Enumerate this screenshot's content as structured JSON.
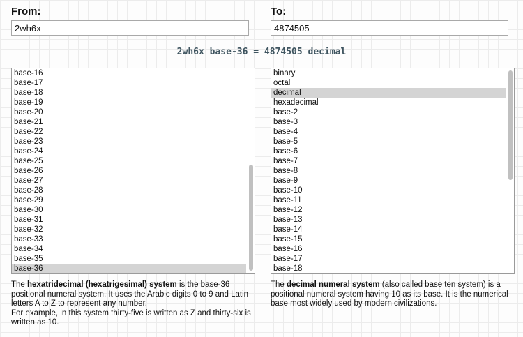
{
  "from": {
    "label": "From:",
    "value": "2wh6x"
  },
  "to": {
    "label": "To:",
    "value": "4874505"
  },
  "result_text": "2wh6x base-36 = 4874505 decimal",
  "from_list": {
    "items": [
      "base-16",
      "base-17",
      "base-18",
      "base-19",
      "base-20",
      "base-21",
      "base-22",
      "base-23",
      "base-24",
      "base-25",
      "base-26",
      "base-27",
      "base-28",
      "base-29",
      "base-30",
      "base-31",
      "base-32",
      "base-33",
      "base-34",
      "base-35",
      "base-36"
    ],
    "selected": "base-36"
  },
  "to_list": {
    "items": [
      "binary",
      "octal",
      "decimal",
      "hexadecimal",
      "base-2",
      "base-3",
      "base-4",
      "base-5",
      "base-6",
      "base-7",
      "base-8",
      "base-9",
      "base-10",
      "base-11",
      "base-12",
      "base-13",
      "base-14",
      "base-15",
      "base-16",
      "base-17",
      "base-18"
    ],
    "selected": "decimal"
  },
  "from_desc": {
    "pre": "The ",
    "bold": "hexatridecimal (hexatrigesimal) system",
    "post": " is the base-36 positional numeral system. It uses the Arabic digits 0 to 9 and Latin letters A to Z to represent any number.",
    "line2": "For example, in this system thirty-five is written as Z and thirty-six is written as 10."
  },
  "to_desc": {
    "pre": "The ",
    "bold": "decimal numeral system",
    "post": " (also called base ten system) is a positional numeral system having 10 as its base. It is the numerical base most widely used by modern civilizations."
  }
}
